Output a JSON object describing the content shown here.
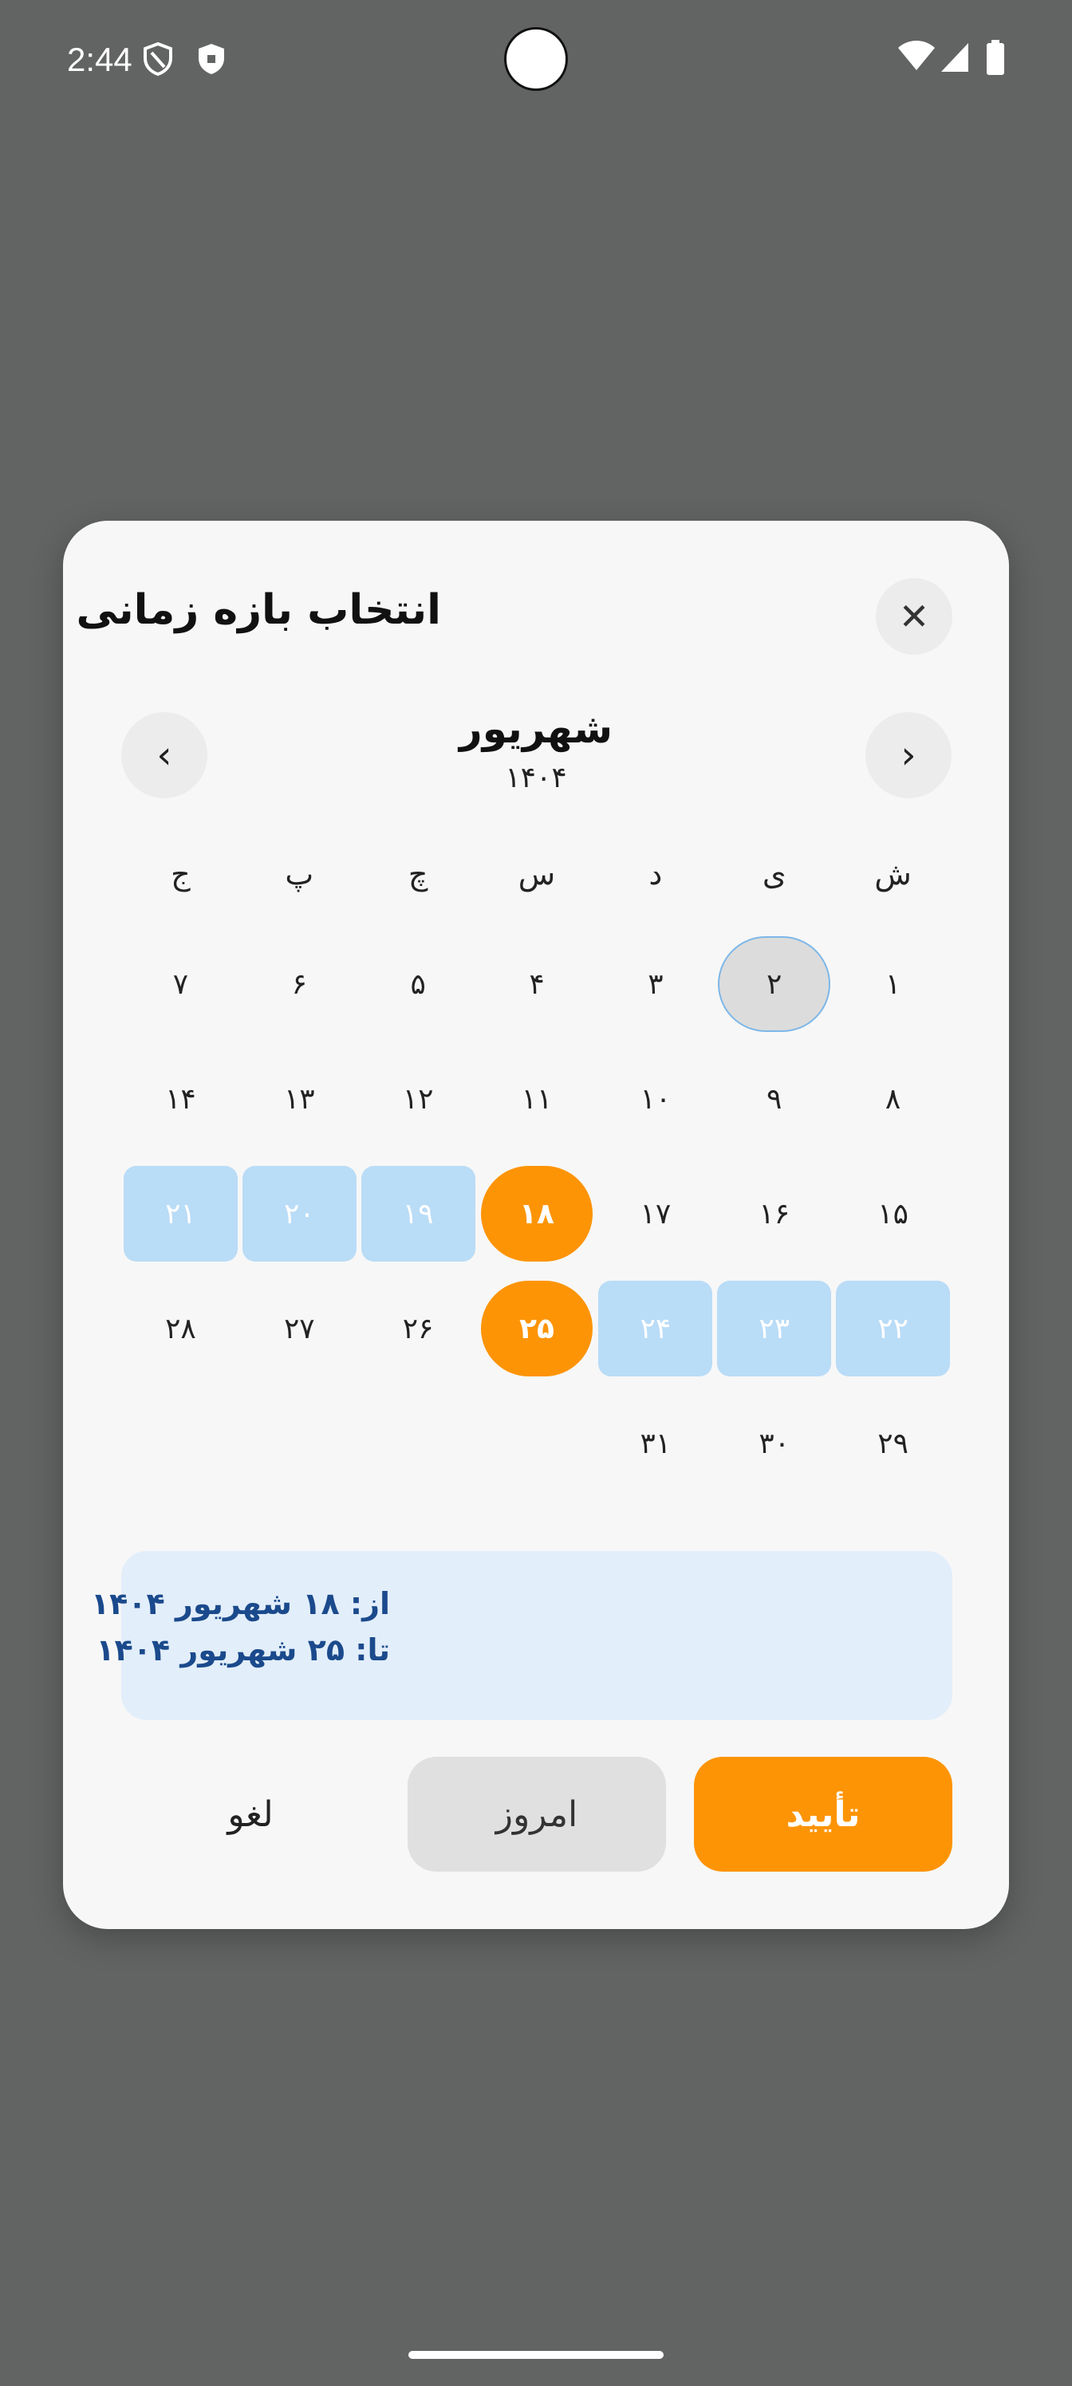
{
  "status_bar": {
    "time": "2:44",
    "icons": [
      "vpn-shield-icon",
      "security-shield-icon",
      "wifi-icon",
      "signal-icon",
      "battery-icon"
    ]
  },
  "dialog": {
    "title": "انتخاب بازه زمانی",
    "close_icon": "close-icon",
    "month": "شهریور",
    "year": "۱۴۰۴",
    "prev_icon": "chevron-left-icon",
    "next_icon": "chevron-right-icon",
    "weekdays": [
      "ش",
      "ی",
      "د",
      "س",
      "چ",
      "پ",
      "ج"
    ],
    "days": [
      {
        "label": "۱",
        "state": ""
      },
      {
        "label": "۲",
        "state": "today"
      },
      {
        "label": "۳",
        "state": ""
      },
      {
        "label": "۴",
        "state": ""
      },
      {
        "label": "۵",
        "state": ""
      },
      {
        "label": "۶",
        "state": ""
      },
      {
        "label": "۷",
        "state": ""
      },
      {
        "label": "۸",
        "state": ""
      },
      {
        "label": "۹",
        "state": ""
      },
      {
        "label": "۱۰",
        "state": ""
      },
      {
        "label": "۱۱",
        "state": ""
      },
      {
        "label": "۱۲",
        "state": ""
      },
      {
        "label": "۱۳",
        "state": ""
      },
      {
        "label": "۱۴",
        "state": ""
      },
      {
        "label": "۱۵",
        "state": ""
      },
      {
        "label": "۱۶",
        "state": ""
      },
      {
        "label": "۱۷",
        "state": ""
      },
      {
        "label": "۱۸",
        "state": "endpoint"
      },
      {
        "label": "۱۹",
        "state": "range"
      },
      {
        "label": "۲۰",
        "state": "range"
      },
      {
        "label": "۲۱",
        "state": "range"
      },
      {
        "label": "۲۲",
        "state": "range"
      },
      {
        "label": "۲۳",
        "state": "range"
      },
      {
        "label": "۲۴",
        "state": "range"
      },
      {
        "label": "۲۵",
        "state": "endpoint"
      },
      {
        "label": "۲۶",
        "state": ""
      },
      {
        "label": "۲۷",
        "state": ""
      },
      {
        "label": "۲۸",
        "state": ""
      },
      {
        "label": "۲۹",
        "state": ""
      },
      {
        "label": "۳۰",
        "state": ""
      },
      {
        "label": "۳۱",
        "state": ""
      }
    ],
    "summary": {
      "from": "از: ۱۸ شهریور ۱۴۰۴",
      "to": "تا: ۲۵ شهریور ۱۴۰۴"
    },
    "buttons": {
      "confirm": "تأیید",
      "today": "امروز",
      "cancel": "لغو"
    }
  },
  "colors": {
    "accent": "#fd9406",
    "range": "#b9dcf7",
    "summary_bg": "#e2eefa",
    "summary_text": "#1b4a8c",
    "scrim": "#626463"
  }
}
